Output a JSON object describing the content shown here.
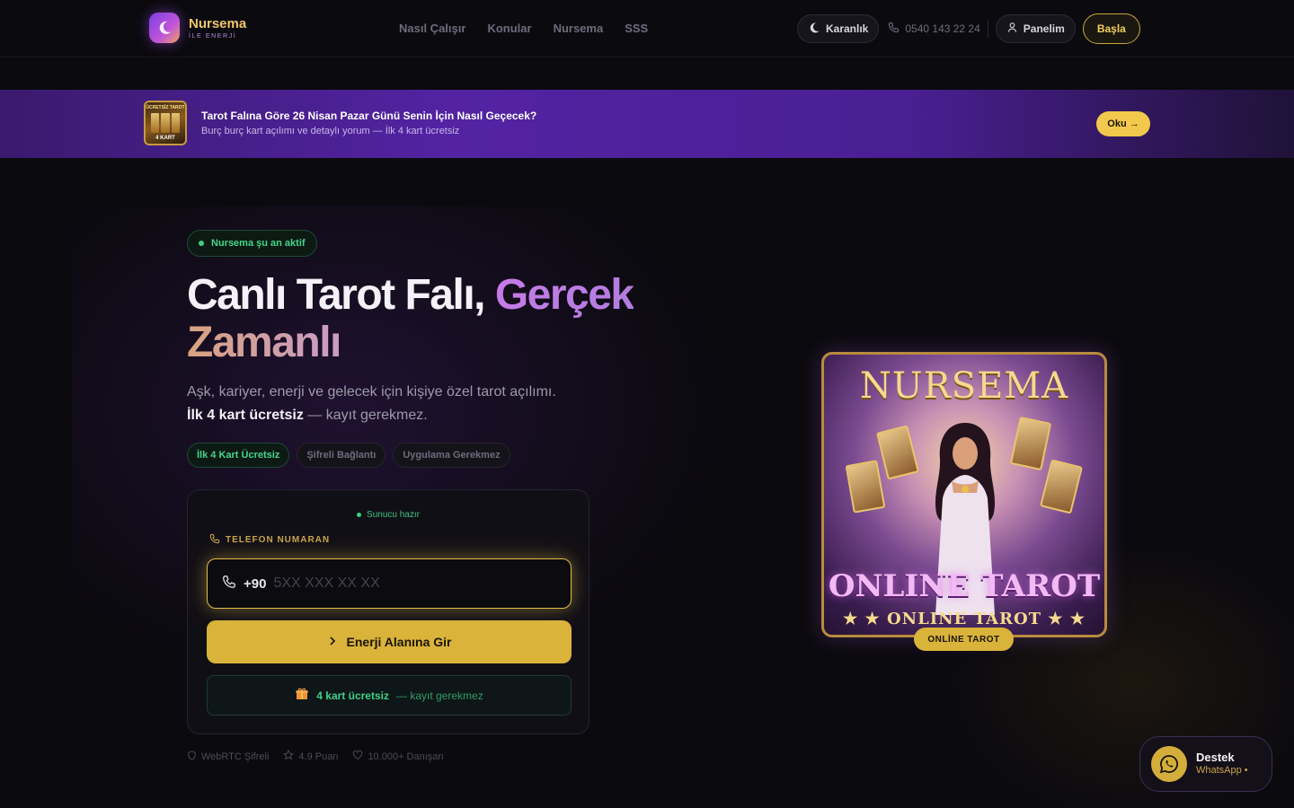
{
  "header": {
    "brand_name": "Nursema",
    "brand_tagline": "İLE ENERJİ",
    "nav": [
      "Nasıl Çalışır",
      "Konular",
      "Nursema",
      "SSS"
    ],
    "theme_label": "Karanlık",
    "phone": "0540 143 22 24",
    "panel_label": "Panelim",
    "start_label": "Başla"
  },
  "banner": {
    "thumb_top": "ÜCRETSİZ TAROT",
    "thumb_bottom": "4 KART",
    "title": "Tarot Falına Göre 26 Nisan Pazar Günü Senin İçin Nasıl Geçecek?",
    "subtitle": "Burç burç kart açılımı ve detaylı yorum — İlk 4 kart ücretsiz",
    "read_label": "Oku →"
  },
  "hero": {
    "status": "Nursema şu an aktif",
    "title_part1": "Canlı Tarot Falı, ",
    "title_accent": "Gerçek",
    "title_accent2": "Zamanlı",
    "desc_line1": "Aşk, kariyer, enerji ve gelecek için kişiye özel tarot açılımı.",
    "desc_bold": "İlk 4 kart ücretsiz",
    "desc_rest": " — kayıt gerekmez.",
    "tags": [
      "İlk 4 Kart Ücretsiz",
      "Şifreli Bağlantı",
      "Uygulama Gerekmez"
    ]
  },
  "form": {
    "server_status": "Sunucu hazır",
    "phone_label": "TELEFON NUMARAN",
    "country_code": "+90",
    "phone_placeholder": "5XX XXX XX XX",
    "submit_label": "Enerji Alanına Gir",
    "free_highlight": "4 kart ücretsiz",
    "free_rest": "— kayıt gerekmez"
  },
  "trust": [
    "WebRTC Şifreli",
    "4.9 Puan",
    "10.000+ Danışan"
  ],
  "tarot_image": {
    "title": "NURSEMA",
    "main_label": "ONLINE TAROT",
    "sub_label": "★ ★ ONLINE TAROT ★ ★",
    "badge": "ONLİNE TAROT"
  },
  "support": {
    "title": "Destek",
    "subtitle": "WhatsApp •"
  },
  "colors": {
    "background": "#0b0a0f",
    "accent_gold": "#d9b33a",
    "accent_green": "#43d68c",
    "accent_purple": "#c57be6",
    "banner_purple": "#5323a3"
  }
}
